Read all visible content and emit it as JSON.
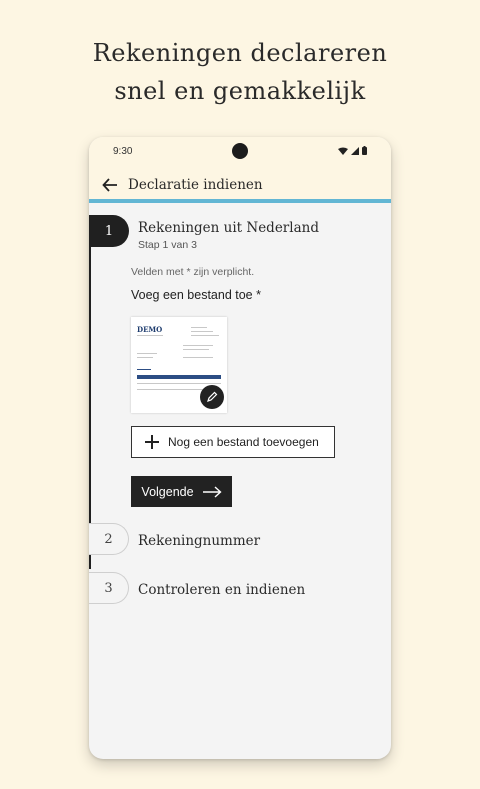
{
  "promo": {
    "line1": "Rekeningen declareren",
    "line2": "snel en gemakkelijk"
  },
  "statusbar": {
    "time": "9:30",
    "icons": [
      "wifi-icon",
      "signal-icon",
      "battery-icon"
    ]
  },
  "appbar": {
    "back_icon": "arrow-left-icon",
    "title": "Declaratie indienen"
  },
  "steps": [
    {
      "number": "1",
      "title": "Rekeningen uit Nederland",
      "subtitle": "Stap 1 van 3",
      "state": "active"
    },
    {
      "number": "2",
      "title": "Rekeningnummer",
      "state": "inactive"
    },
    {
      "number": "3",
      "title": "Controleren en indienen",
      "state": "inactive"
    }
  ],
  "form": {
    "required_hint": "Velden met * zijn verplicht.",
    "file_label": "Voeg een bestand toe *",
    "document_preview": {
      "logo": "DEMO",
      "edit_icon": "pencil-icon"
    },
    "add_file_button": {
      "icon": "plus-icon",
      "label": "Nog een bestand toevoegen"
    },
    "next_button": {
      "label": "Volgende",
      "icon": "arrow-right-icon"
    }
  },
  "colors": {
    "background": "#fdf6e3",
    "accent": "#62b6d4",
    "primary": "#202020"
  }
}
